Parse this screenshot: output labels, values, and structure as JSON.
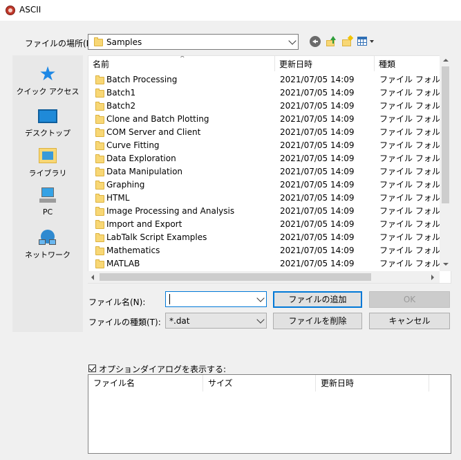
{
  "window": {
    "title": "ASCII"
  },
  "location": {
    "label": "ファイルの場所(I):",
    "value": "Samples"
  },
  "places": [
    {
      "name": "quick-access",
      "label": "クイック アクセス"
    },
    {
      "name": "desktop",
      "label": "デスクトップ"
    },
    {
      "name": "libraries",
      "label": "ライブラリ"
    },
    {
      "name": "pc",
      "label": "PC"
    },
    {
      "name": "network",
      "label": "ネットワーク"
    }
  ],
  "file_list": {
    "columns": [
      "名前",
      "更新日時",
      "種類"
    ],
    "rows": [
      {
        "name": "Batch Processing",
        "date": "2021/07/05 14:09",
        "type": "ファイル フォルダー"
      },
      {
        "name": "Batch1",
        "date": "2021/07/05 14:09",
        "type": "ファイル フォルダー"
      },
      {
        "name": "Batch2",
        "date": "2021/07/05 14:09",
        "type": "ファイル フォルダー"
      },
      {
        "name": "Clone and Batch Plotting",
        "date": "2021/07/05 14:09",
        "type": "ファイル フォルダー"
      },
      {
        "name": "COM Server and Client",
        "date": "2021/07/05 14:09",
        "type": "ファイル フォルダー"
      },
      {
        "name": "Curve Fitting",
        "date": "2021/07/05 14:09",
        "type": "ファイル フォルダー"
      },
      {
        "name": "Data Exploration",
        "date": "2021/07/05 14:09",
        "type": "ファイル フォルダー"
      },
      {
        "name": "Data Manipulation",
        "date": "2021/07/05 14:09",
        "type": "ファイル フォルダー"
      },
      {
        "name": "Graphing",
        "date": "2021/07/05 14:09",
        "type": "ファイル フォルダー"
      },
      {
        "name": "HTML",
        "date": "2021/07/05 14:09",
        "type": "ファイル フォルダー"
      },
      {
        "name": "Image Processing and Analysis",
        "date": "2021/07/05 14:09",
        "type": "ファイル フォルダー"
      },
      {
        "name": "Import and Export",
        "date": "2021/07/05 14:09",
        "type": "ファイル フォルダー"
      },
      {
        "name": "LabTalk Script Examples",
        "date": "2021/07/05 14:09",
        "type": "ファイル フォルダー"
      },
      {
        "name": "Mathematics",
        "date": "2021/07/05 14:09",
        "type": "ファイル フォルダー"
      },
      {
        "name": "MATLAB",
        "date": "2021/07/05 14:09",
        "type": "ファイル フォルダー"
      }
    ]
  },
  "filename": {
    "label": "ファイル名(N):",
    "value": ""
  },
  "filetype": {
    "label": "ファイルの種類(T):",
    "value": "*.dat"
  },
  "buttons": {
    "add": "ファイルの追加",
    "ok": "OK",
    "remove": "ファイルを削除",
    "cancel": "キャンセル"
  },
  "options": {
    "checkbox_label": "オプションダイアログを表示する:",
    "checked": true,
    "columns": [
      "ファイル名",
      "サイズ",
      "更新日時"
    ]
  }
}
